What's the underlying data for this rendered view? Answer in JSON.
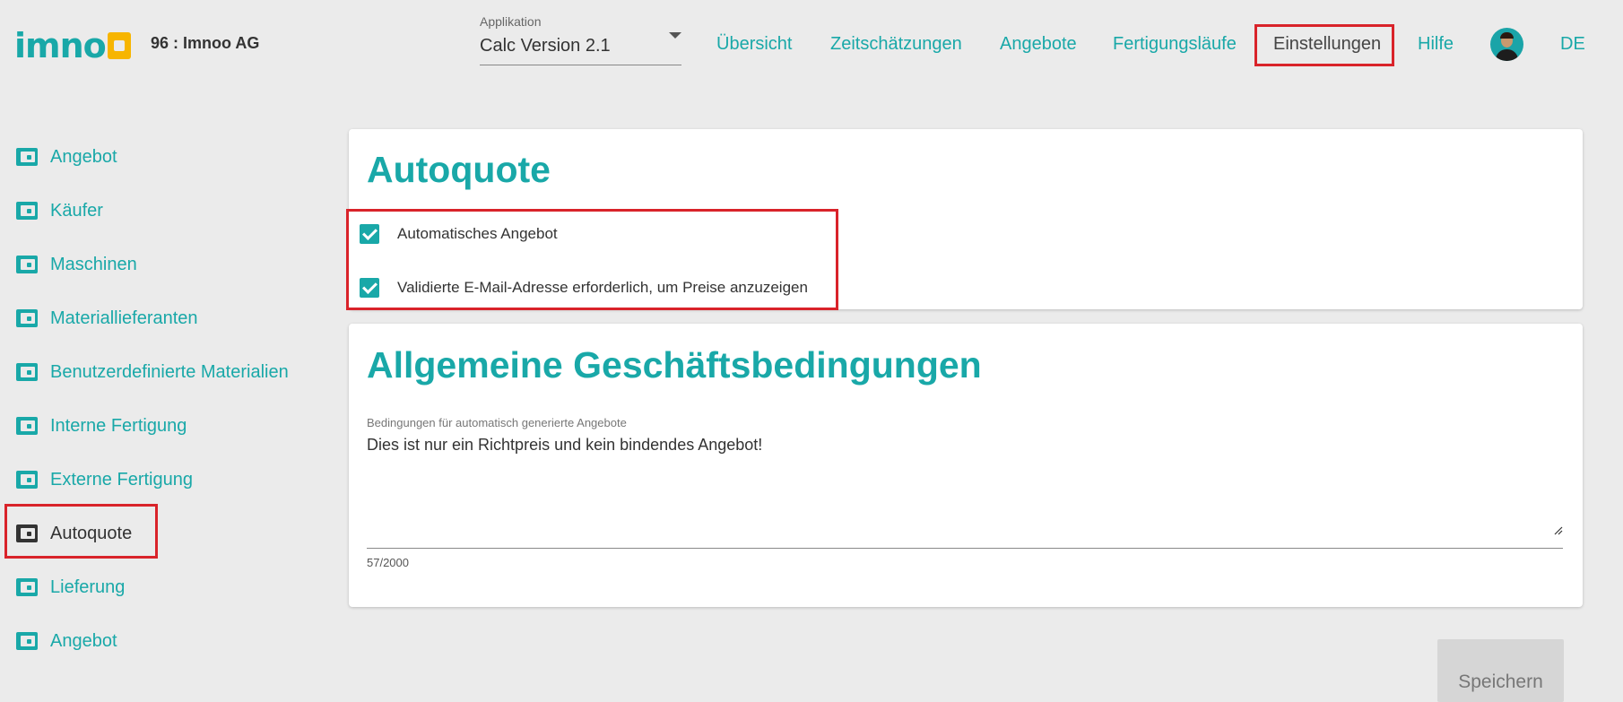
{
  "header": {
    "logo_text": "imno",
    "company": "96 : Imnoo AG",
    "app_select": {
      "label": "Applikation",
      "value": "Calc Version 2.1"
    },
    "nav": [
      {
        "label": "Übersicht"
      },
      {
        "label": "Zeitschätzungen"
      },
      {
        "label": "Angebote"
      },
      {
        "label": "Fertigungsläufe"
      },
      {
        "label": "Einstellungen",
        "active": true
      },
      {
        "label": "Hilfe"
      }
    ],
    "language": "DE"
  },
  "sidebar": {
    "items": [
      {
        "label": "Angebot"
      },
      {
        "label": "Käufer"
      },
      {
        "label": "Maschinen"
      },
      {
        "label": "Materiallieferanten"
      },
      {
        "label": "Benutzerdefinierte Materialien"
      },
      {
        "label": "Interne Fertigung"
      },
      {
        "label": "Externe Fertigung"
      },
      {
        "label": "Autoquote",
        "active": true
      },
      {
        "label": "Lieferung"
      },
      {
        "label": "Angebot"
      }
    ]
  },
  "autoquote": {
    "title": "Autoquote",
    "checkboxes": [
      {
        "label": "Automatisches Angebot",
        "checked": true
      },
      {
        "label": "Validierte E-Mail-Adresse erforderlich, um Preise anzuzeigen",
        "checked": true
      }
    ]
  },
  "agb": {
    "title": "Allgemeine Geschäftsbedingungen",
    "field_label": "Bedingungen für automatisch generierte Angebote",
    "value": "Dies ist nur ein Richtpreis und kein bindendes Angebot!",
    "counter": "57/2000"
  },
  "save_label": "Speichern",
  "colors": {
    "accent": "#19a8a8",
    "logo_box": "#f7b500",
    "highlight": "#d9232a"
  }
}
